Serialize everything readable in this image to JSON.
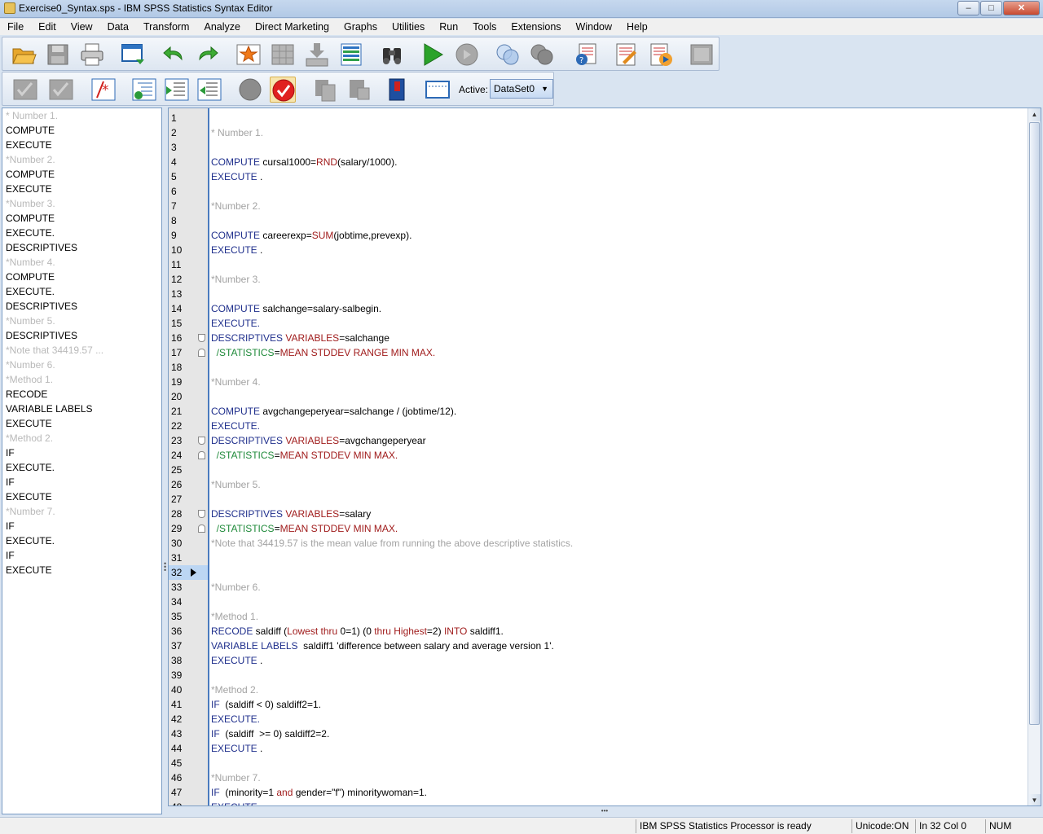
{
  "window": {
    "title": "Exercise0_Syntax.sps - IBM SPSS Statistics Syntax Editor",
    "controls": [
      "minimize",
      "maximize",
      "close"
    ]
  },
  "menu": [
    "File",
    "Edit",
    "View",
    "Data",
    "Transform",
    "Analyze",
    "Direct Marketing",
    "Graphs",
    "Utilities",
    "Run",
    "Tools",
    "Extensions",
    "Window",
    "Help"
  ],
  "toolbar1_icons": [
    "open-folder-icon",
    "save-icon",
    "print-icon",
    "recall-dialog-icon",
    "undo-icon",
    "redo-icon",
    "goto-case-icon",
    "goto-variable-icon",
    "insert-cases-icon",
    "variables-icon",
    "find-icon",
    "run-icon",
    "stop-icon",
    "select-cases-icon",
    "value-labels-icon",
    "syntax-help-icon",
    "bookmark-icon",
    "run-to-end-icon",
    "full-screen-icon"
  ],
  "toolbar2_icons": [
    "comment-icon",
    "uncomment-icon",
    "asterisk-icon",
    "outdent-icon",
    "indent-icon",
    "unindent-icon",
    "breakpoint-icon",
    "validate-icon",
    "copy-icon",
    "paste-icon",
    "book-icon",
    "ruler-icon"
  ],
  "active_dataset": {
    "label": "Active:",
    "value": "DataSet0"
  },
  "navigation": [
    {
      "text": "* Number 1.",
      "muted": true
    },
    {
      "text": "COMPUTE",
      "muted": false
    },
    {
      "text": "EXECUTE",
      "muted": false
    },
    {
      "text": "*Number 2.",
      "muted": true
    },
    {
      "text": "COMPUTE",
      "muted": false
    },
    {
      "text": "EXECUTE",
      "muted": false
    },
    {
      "text": "*Number 3.",
      "muted": true
    },
    {
      "text": "COMPUTE",
      "muted": false
    },
    {
      "text": "EXECUTE.",
      "muted": false
    },
    {
      "text": "DESCRIPTIVES",
      "muted": false
    },
    {
      "text": "*Number 4.",
      "muted": true
    },
    {
      "text": "COMPUTE",
      "muted": false
    },
    {
      "text": "EXECUTE.",
      "muted": false
    },
    {
      "text": "DESCRIPTIVES",
      "muted": false
    },
    {
      "text": "*Number 5.",
      "muted": true
    },
    {
      "text": "DESCRIPTIVES",
      "muted": false
    },
    {
      "text": "*Note that 34419.57 ...",
      "muted": true
    },
    {
      "text": "*Number 6.",
      "muted": true
    },
    {
      "text": "*Method 1.",
      "muted": true
    },
    {
      "text": "RECODE",
      "muted": false
    },
    {
      "text": "VARIABLE LABELS",
      "muted": false
    },
    {
      "text": "EXECUTE",
      "muted": false
    },
    {
      "text": "*Method 2.",
      "muted": true
    },
    {
      "text": "IF",
      "muted": false
    },
    {
      "text": "EXECUTE.",
      "muted": false
    },
    {
      "text": "IF",
      "muted": false
    },
    {
      "text": "EXECUTE",
      "muted": false
    },
    {
      "text": "*Number 7.",
      "muted": true
    },
    {
      "text": "IF",
      "muted": false
    },
    {
      "text": "EXECUTE.",
      "muted": false
    },
    {
      "text": "IF",
      "muted": false
    },
    {
      "text": "EXECUTE",
      "muted": false
    }
  ],
  "editor": {
    "current_line": 32,
    "lines": [
      {
        "n": "1",
        "tokens": []
      },
      {
        "n": "2",
        "tokens": [
          {
            "t": "* Number 1.",
            "c": "cm"
          }
        ]
      },
      {
        "n": "3",
        "tokens": []
      },
      {
        "n": "4",
        "tokens": [
          {
            "t": "COMPUTE",
            "c": "kw"
          },
          {
            "t": " cursal1000=",
            "c": ""
          },
          {
            "t": "RND",
            "c": "sub"
          },
          {
            "t": "(salary/1000).",
            "c": ""
          }
        ]
      },
      {
        "n": "5",
        "tokens": [
          {
            "t": "EXECUTE",
            "c": "kw"
          },
          {
            "t": " .",
            "c": ""
          }
        ]
      },
      {
        "n": "6",
        "tokens": []
      },
      {
        "n": "7",
        "tokens": [
          {
            "t": "*Number 2.",
            "c": "cm"
          }
        ]
      },
      {
        "n": "8",
        "tokens": []
      },
      {
        "n": "9",
        "tokens": [
          {
            "t": "COMPUTE",
            "c": "kw"
          },
          {
            "t": " careerexp=",
            "c": ""
          },
          {
            "t": "SUM",
            "c": "sub"
          },
          {
            "t": "(jobtime,prevexp).",
            "c": ""
          }
        ]
      },
      {
        "n": "10",
        "tokens": [
          {
            "t": "EXECUTE",
            "c": "kw"
          },
          {
            "t": " .",
            "c": ""
          }
        ]
      },
      {
        "n": "11",
        "tokens": []
      },
      {
        "n": "12",
        "tokens": [
          {
            "t": "*Number 3.",
            "c": "cm"
          }
        ]
      },
      {
        "n": "13",
        "tokens": []
      },
      {
        "n": "14",
        "tokens": [
          {
            "t": "COMPUTE",
            "c": "kw"
          },
          {
            "t": " salchange=salary-salbegin.",
            "c": ""
          }
        ]
      },
      {
        "n": "15",
        "tokens": [
          {
            "t": "EXECUTE.",
            "c": "kw"
          }
        ]
      },
      {
        "n": "16",
        "fold": "top",
        "tokens": [
          {
            "t": "DESCRIPTIVES",
            "c": "kw"
          },
          {
            "t": " ",
            "c": ""
          },
          {
            "t": "VARIABLES",
            "c": "sub"
          },
          {
            "t": "=salchange",
            "c": ""
          }
        ]
      },
      {
        "n": "17",
        "fold": "bottom",
        "tokens": [
          {
            "t": "  /STATISTICS",
            "c": "slash"
          },
          {
            "t": "=",
            "c": ""
          },
          {
            "t": "MEAN STDDEV RANGE MIN MAX.",
            "c": "sub"
          }
        ]
      },
      {
        "n": "18",
        "tokens": []
      },
      {
        "n": "19",
        "tokens": [
          {
            "t": "*Number 4.",
            "c": "cm"
          }
        ]
      },
      {
        "n": "20",
        "tokens": []
      },
      {
        "n": "21",
        "tokens": [
          {
            "t": "COMPUTE",
            "c": "kw"
          },
          {
            "t": " avgchangeperyear=salchange / (jobtime/12).",
            "c": ""
          }
        ]
      },
      {
        "n": "22",
        "tokens": [
          {
            "t": "EXECUTE.",
            "c": "kw"
          }
        ]
      },
      {
        "n": "23",
        "fold": "top",
        "tokens": [
          {
            "t": "DESCRIPTIVES",
            "c": "kw"
          },
          {
            "t": " ",
            "c": ""
          },
          {
            "t": "VARIABLES",
            "c": "sub"
          },
          {
            "t": "=avgchangeperyear",
            "c": ""
          }
        ]
      },
      {
        "n": "24",
        "fold": "bottom",
        "tokens": [
          {
            "t": "  /STATISTICS",
            "c": "slash"
          },
          {
            "t": "=",
            "c": ""
          },
          {
            "t": "MEAN STDDEV MIN MAX.",
            "c": "sub"
          }
        ]
      },
      {
        "n": "25",
        "tokens": []
      },
      {
        "n": "26",
        "tokens": [
          {
            "t": "*Number 5.",
            "c": "cm"
          }
        ]
      },
      {
        "n": "27",
        "tokens": []
      },
      {
        "n": "28",
        "fold": "top",
        "tokens": [
          {
            "t": "DESCRIPTIVES",
            "c": "kw"
          },
          {
            "t": " ",
            "c": ""
          },
          {
            "t": "VARIABLES",
            "c": "sub"
          },
          {
            "t": "=salary",
            "c": ""
          }
        ]
      },
      {
        "n": "29",
        "fold": "bottom",
        "tokens": [
          {
            "t": "  /STATISTICS",
            "c": "slash"
          },
          {
            "t": "=",
            "c": ""
          },
          {
            "t": "MEAN STDDEV MIN MAX.",
            "c": "sub"
          }
        ]
      },
      {
        "n": "30",
        "tokens": [
          {
            "t": "*Note that 34419.57 is the mean value from running the above descriptive statistics.",
            "c": "cm"
          }
        ]
      },
      {
        "n": "31",
        "tokens": []
      },
      {
        "n": "32",
        "tokens": []
      },
      {
        "n": "33",
        "tokens": [
          {
            "t": "*Number 6.",
            "c": "cm"
          }
        ]
      },
      {
        "n": "34",
        "tokens": []
      },
      {
        "n": "35",
        "tokens": [
          {
            "t": "*Method 1.",
            "c": "cm"
          }
        ]
      },
      {
        "n": "36",
        "tokens": [
          {
            "t": "RECODE",
            "c": "kw"
          },
          {
            "t": " saldiff (",
            "c": ""
          },
          {
            "t": "Lowest thru",
            "c": "sub"
          },
          {
            "t": " 0=1) (0 ",
            "c": ""
          },
          {
            "t": "thru Highest",
            "c": "sub"
          },
          {
            "t": "=2) ",
            "c": ""
          },
          {
            "t": "INTO",
            "c": "sub"
          },
          {
            "t": " saldiff1.",
            "c": ""
          }
        ]
      },
      {
        "n": "37",
        "tokens": [
          {
            "t": "VARIABLE LABELS",
            "c": "kw"
          },
          {
            "t": "  saldiff1 'difference between salary and average version 1'.",
            "c": ""
          }
        ]
      },
      {
        "n": "38",
        "tokens": [
          {
            "t": "EXECUTE",
            "c": "kw"
          },
          {
            "t": " .",
            "c": ""
          }
        ]
      },
      {
        "n": "39",
        "tokens": []
      },
      {
        "n": "40",
        "tokens": [
          {
            "t": "*Method 2.",
            "c": "cm"
          }
        ]
      },
      {
        "n": "41",
        "tokens": [
          {
            "t": "IF",
            "c": "kw"
          },
          {
            "t": "  (saldiff < 0) saldiff2=1.",
            "c": ""
          }
        ]
      },
      {
        "n": "42",
        "tokens": [
          {
            "t": "EXECUTE.",
            "c": "kw"
          }
        ]
      },
      {
        "n": "43",
        "tokens": [
          {
            "t": "IF",
            "c": "kw"
          },
          {
            "t": "  (saldiff  >= 0) saldiff2=2.",
            "c": ""
          }
        ]
      },
      {
        "n": "44",
        "tokens": [
          {
            "t": "EXECUTE",
            "c": "kw"
          },
          {
            "t": " .",
            "c": ""
          }
        ]
      },
      {
        "n": "45",
        "tokens": []
      },
      {
        "n": "46",
        "tokens": [
          {
            "t": "*Number 7.",
            "c": "cm"
          }
        ]
      },
      {
        "n": "47",
        "tokens": [
          {
            "t": "IF",
            "c": "kw"
          },
          {
            "t": "  (minority=1 ",
            "c": ""
          },
          {
            "t": "and",
            "c": "sub"
          },
          {
            "t": " gender=\"f\") minoritywoman=1.",
            "c": ""
          }
        ]
      },
      {
        "n": "48",
        "tokens": [
          {
            "t": "EXECUTE.",
            "c": "kw"
          }
        ]
      }
    ]
  },
  "status": {
    "processor": "IBM SPSS Statistics Processor is ready",
    "unicode": "Unicode:ON",
    "position": "In 32 Col 0",
    "numlock": "NUM"
  }
}
